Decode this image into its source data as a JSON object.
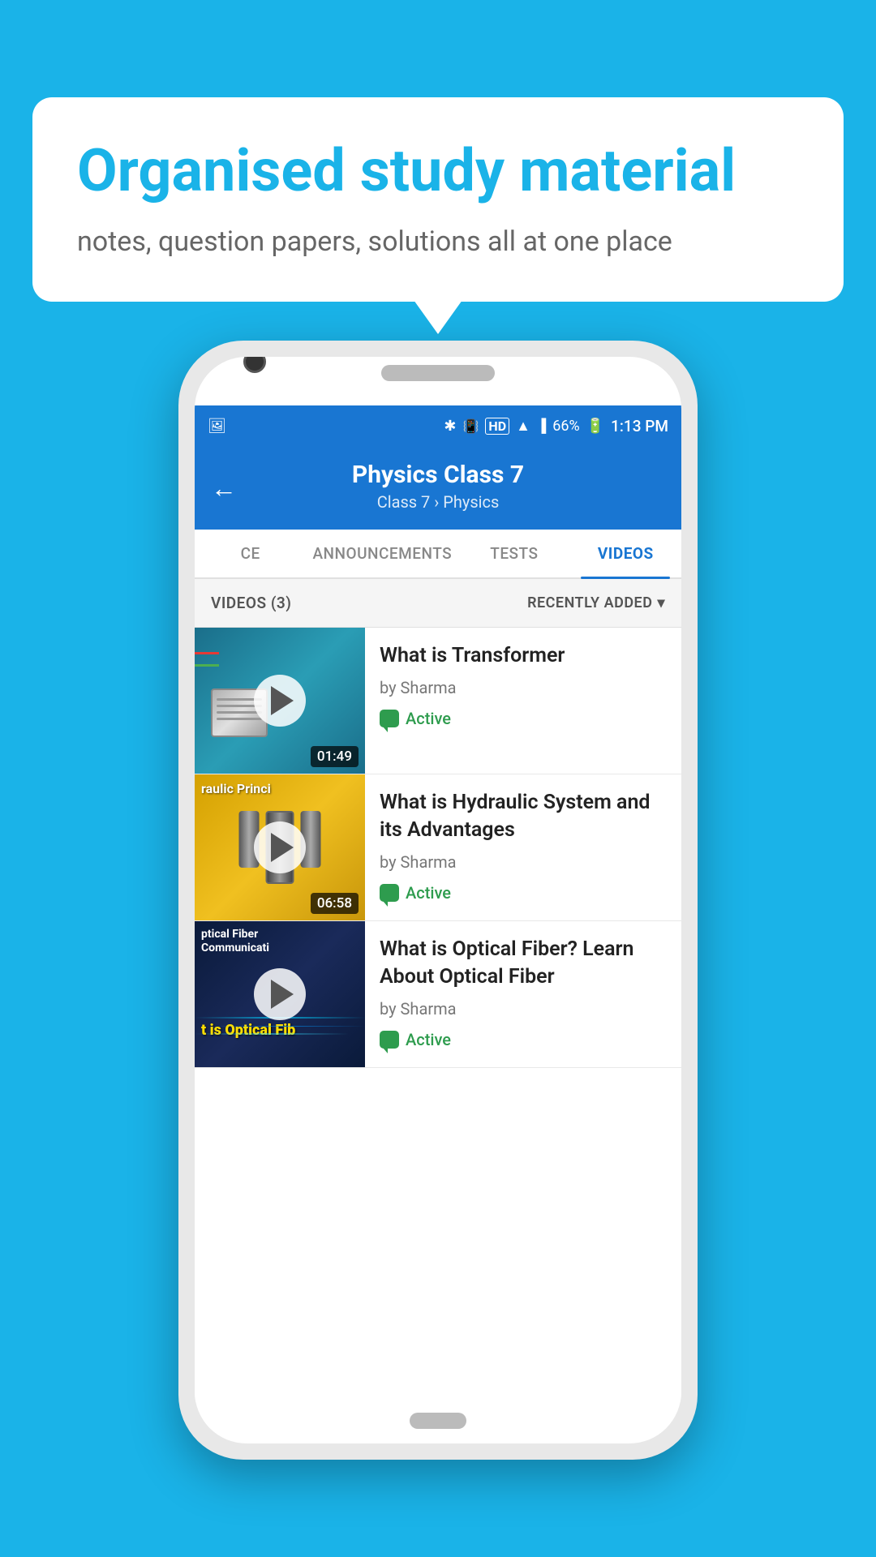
{
  "bubble": {
    "title": "Organised study material",
    "subtitle": "notes, question papers, solutions all at one place"
  },
  "status_bar": {
    "battery": "66%",
    "time": "1:13 PM",
    "signal_icons": "HD"
  },
  "header": {
    "title": "Physics Class 7",
    "subtitle_part1": "Class 7",
    "subtitle_sep": "›",
    "subtitle_part2": "Physics",
    "back_label": "←"
  },
  "tabs": [
    {
      "label": "CE",
      "active": false
    },
    {
      "label": "ANNOUNCEMENTS",
      "active": false
    },
    {
      "label": "TESTS",
      "active": false
    },
    {
      "label": "VIDEOS",
      "active": true
    }
  ],
  "list_header": {
    "count_label": "VIDEOS (3)",
    "sort_label": "RECENTLY ADDED",
    "sort_icon": "▾"
  },
  "videos": [
    {
      "id": 1,
      "title": "What is  Transformer",
      "author": "by Sharma",
      "status": "Active",
      "duration": "01:49",
      "thumb_label": ""
    },
    {
      "id": 2,
      "title": "What is Hydraulic System and its Advantages",
      "author": "by Sharma",
      "status": "Active",
      "duration": "06:58",
      "thumb_label": "raulic Princi"
    },
    {
      "id": 3,
      "title": "What is Optical Fiber? Learn About Optical Fiber",
      "author": "by Sharma",
      "status": "Active",
      "duration": "",
      "thumb_label": "ptical Fiber Communicati"
    }
  ],
  "active_color": "#2e9c4e",
  "brand_color": "#1976d2",
  "bg_color": "#1ab3e8"
}
